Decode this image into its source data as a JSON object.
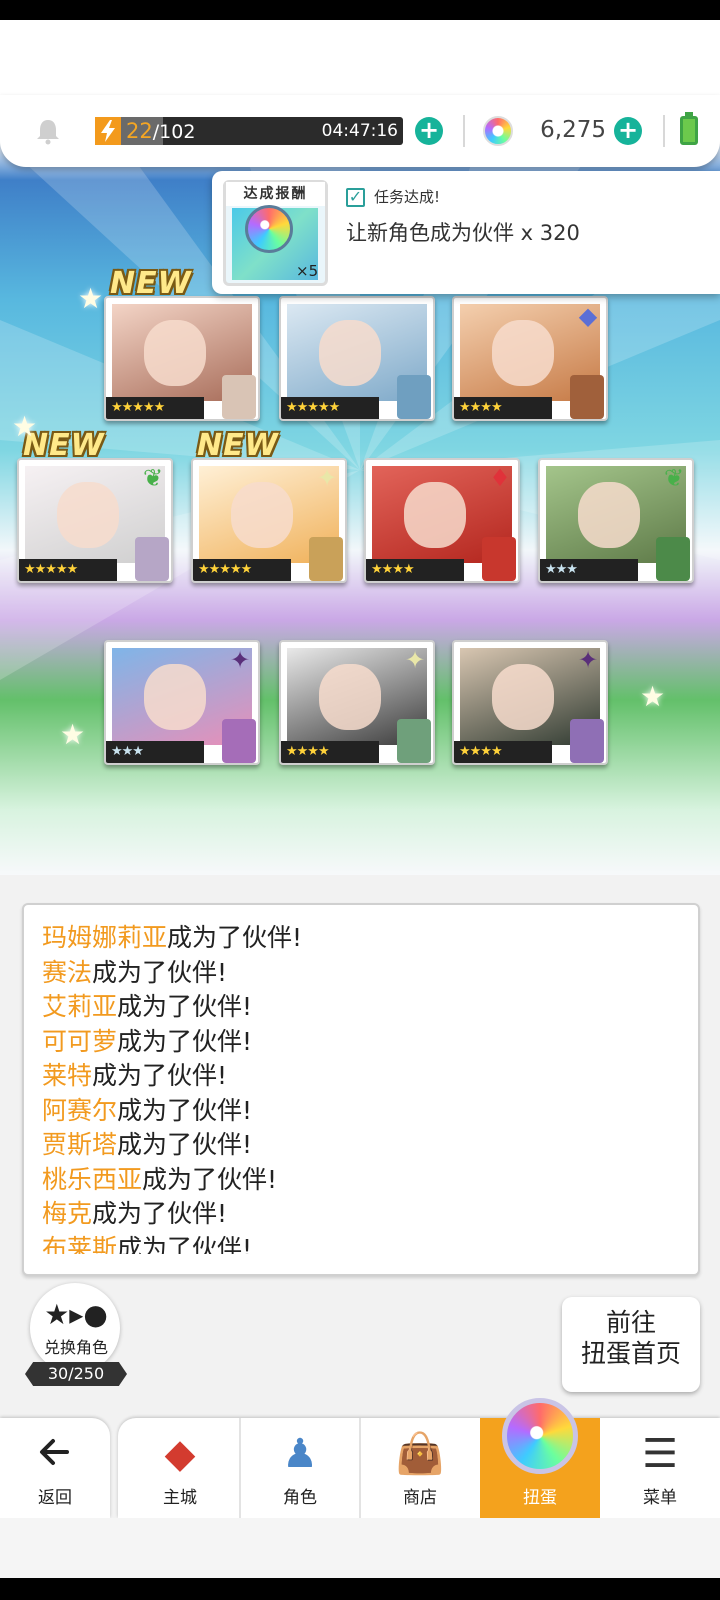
{
  "header": {
    "stamina_current": "22",
    "stamina_sep": "/",
    "stamina_max": "102",
    "stamina_fraction": 0.216,
    "timer": "04:47:16",
    "gems": "6,275",
    "icons": [
      "bell-icon",
      "bolt-icon",
      "plus-icon",
      "gem-icon",
      "battery-icon"
    ]
  },
  "mission": {
    "reward_label": "达成报酬",
    "reward_qty": "×5",
    "status": "任务达成!",
    "description": "让新角色成为伙伴  x 320"
  },
  "cards": [
    {
      "stars": "★★★★★",
      "new": true,
      "art_colors": [
        "#a86d5a",
        "#f3d4c6"
      ],
      "sprite": "#d9c4b5"
    },
    {
      "stars": "★★★★★",
      "new": false,
      "art_colors": [
        "#7ea9c9",
        "#dbe8f2"
      ],
      "sprite": "#6f9fc0"
    },
    {
      "stars": "★★★★",
      "new": false,
      "art_colors": [
        "#c67a46",
        "#f4cfae"
      ],
      "sprite": "#a0603b",
      "badge": "shield"
    },
    {
      "stars": "★★★★★",
      "new": true,
      "art_colors": [
        "#cfcfcf",
        "#f6f1f3"
      ],
      "sprite": "#b6a6c6",
      "badge": "leaf"
    },
    {
      "stars": "★★★★★",
      "new": true,
      "art_colors": [
        "#f0b15a",
        "#fff0d6"
      ],
      "sprite": "#c9a159",
      "badge": "sparkle"
    },
    {
      "stars": "★★★★",
      "new": false,
      "art_colors": [
        "#b3261e",
        "#e2645a"
      ],
      "sprite": "#c8372d",
      "badge": "diamond"
    },
    {
      "stars": "★★★",
      "new": false,
      "art_colors": [
        "#5e7a48",
        "#a4c58b"
      ],
      "sprite": "#4c8a49",
      "badge": "leaf",
      "silver": true
    },
    {
      "stars": "★★★",
      "new": false,
      "art_colors": [
        "#e88fb8",
        "#7fb5e8"
      ],
      "sprite": "#a56db8",
      "badge": "dark",
      "silver": true
    },
    {
      "stars": "★★★★",
      "new": false,
      "art_colors": [
        "#3b3b3b",
        "#e9e9e9"
      ],
      "sprite": "#6fa07b",
      "badge": "sparkle"
    },
    {
      "stars": "★★★★",
      "new": false,
      "art_colors": [
        "#2f3a31",
        "#d8c6b1"
      ],
      "sprite": "#8f6fb5",
      "badge": "dark"
    }
  ],
  "new_label": "NEW",
  "log": [
    {
      "name": "玛姆娜莉亚",
      "text": "成为了伙伴!"
    },
    {
      "name": "赛法",
      "text": "成为了伙伴!"
    },
    {
      "name": "艾莉亚",
      "text": "成为了伙伴!"
    },
    {
      "name": "可可萝",
      "text": "成为了伙伴!"
    },
    {
      "name": "莱特",
      "text": "成为了伙伴!"
    },
    {
      "name": "阿赛尔",
      "text": "成为了伙伴!"
    },
    {
      "name": "贾斯塔",
      "text": "成为了伙伴!"
    },
    {
      "name": "桃乐西亚",
      "text": "成为了伙伴!"
    },
    {
      "name": "梅克",
      "text": "成为了伙伴!"
    },
    {
      "name": "布莱斯",
      "text": "成为了伙伴!"
    }
  ],
  "exchange": {
    "label": "兑换角色",
    "count": "30/250"
  },
  "gacha_home": {
    "line1": "前往",
    "line2": "扭蛋首页"
  },
  "nav": {
    "back": "返回",
    "items": [
      "主城",
      "角色",
      "商店",
      "扭蛋",
      "菜单"
    ]
  },
  "colors": {
    "accent_orange": "#f4a21d",
    "teal_plus": "#16b39a",
    "name_orange": "#f29a1f"
  }
}
